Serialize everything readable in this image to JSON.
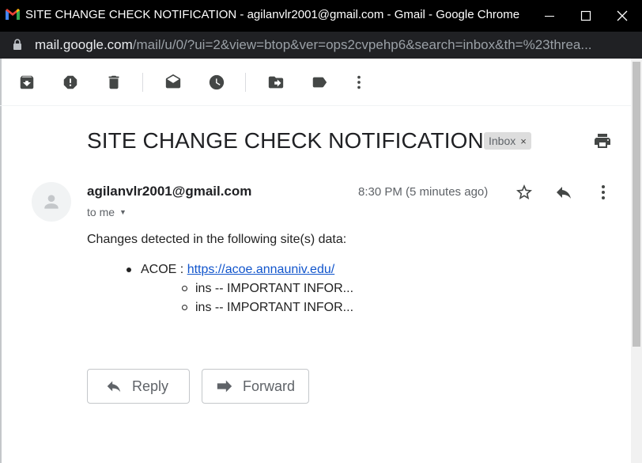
{
  "window": {
    "title": "SITE CHANGE CHECK NOTIFICATION - agilanvlr2001@gmail.com - Gmail - Google Chrome",
    "logo_icon": "gmail-icon",
    "controls": [
      "minimize-icon",
      "maximize-icon",
      "close-icon"
    ]
  },
  "address_bar": {
    "host": "mail.google.com",
    "path": "/mail/u/0/?ui=2&view=btop&ver=ops2cvpehp6&search=inbox&th=%23threa..."
  },
  "toolbar": {
    "icons": [
      "archive-icon",
      "report-spam-icon",
      "delete-icon",
      "mark-unread-icon",
      "snooze-icon",
      "move-to-icon",
      "label-icon",
      "more-vertical-icon"
    ]
  },
  "email": {
    "subject": "SITE CHANGE CHECK NOTIFICATION",
    "label": "Inbox",
    "label_remove": "×",
    "sender": "agilanvlr2001@gmail.com",
    "recipient": "to me",
    "time": "8:30 PM (5 minutes ago)",
    "intro": "Changes detected in the following site(s) data:",
    "site_label": "ACOE : ",
    "site_link": "https://acoe.annauniv.edu/",
    "changes": [
      "ins -- IMPORTANT INFOR...",
      "ins -- IMPORTANT INFOR..."
    ]
  },
  "actions": {
    "reply": "Reply",
    "forward": "Forward"
  },
  "colors": {
    "titlebar": "#000000",
    "addressbar": "#202124",
    "link": "#1155cc",
    "icon": "#444746"
  }
}
